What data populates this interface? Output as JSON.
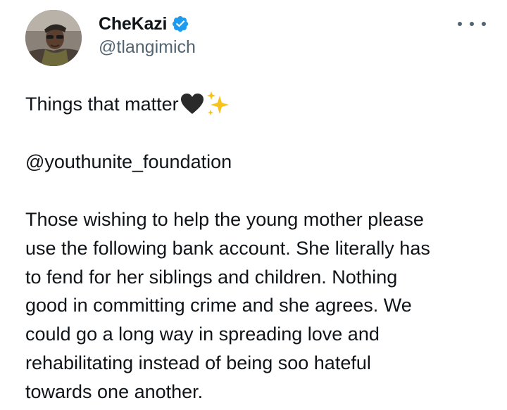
{
  "tweet": {
    "author": {
      "display_name": "CheKazi",
      "handle": "@tlangimich",
      "verified": true,
      "avatar_icon": "profile-photo"
    },
    "more_icon": "ellipsis-icon",
    "first_line_text": "Things that matter",
    "first_line_emojis": [
      "black-heart",
      "sparkles"
    ],
    "mention": "@youthunite_foundation",
    "body_lines": [
      "Those wishing to help the young mother please",
      "use the following bank account.  She literally has",
      "to fend for her siblings and children. Nothing",
      "good in committing crime and she agrees. We",
      "could go a long way in spreading love and",
      "rehabilitating instead of being soo hateful",
      "towards one another."
    ]
  },
  "colors": {
    "text": "#0f1419",
    "secondary_text": "#536471",
    "verified_blue": "#1d9bf0",
    "sparkle_yellow": "#f7c21b"
  }
}
